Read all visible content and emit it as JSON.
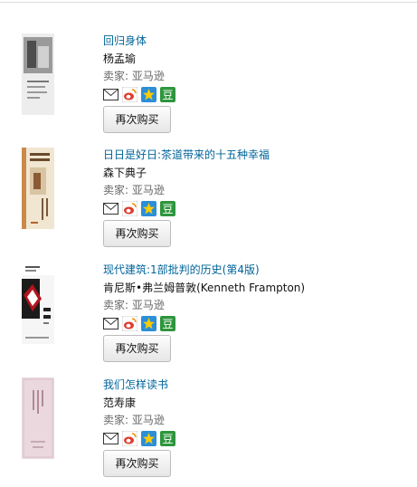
{
  "orders": [
    {
      "title": "回归身体",
      "author": "杨孟瑜",
      "seller": "卖家: 亚马逊",
      "rebuy_label": "再次购买",
      "cover": {
        "bg": "#e8e8e8",
        "accent": "#555555"
      }
    },
    {
      "title": "日日是好日:茶道带来的十五种幸福",
      "author": "森下典子",
      "seller": "卖家: 亚马逊",
      "rebuy_label": "再次购买",
      "cover": {
        "bg": "#efe3cc",
        "accent": "#b6642e"
      }
    },
    {
      "title": "现代建筑:1部批判的历史(第4版)",
      "author": "肯尼斯•弗兰姆普敦(Kenneth Frampton)",
      "seller": "卖家: 亚马逊",
      "rebuy_label": "再次购买",
      "cover": {
        "bg": "#f4f4f4",
        "accent": "#b3141c"
      }
    },
    {
      "title": "我们怎样读书",
      "author": "范寿康",
      "seller": "卖家: 亚马逊",
      "rebuy_label": "再次购买",
      "cover": {
        "bg": "#e9d7dd",
        "accent": "#c7a9b4"
      }
    }
  ],
  "share_icons": [
    "email-icon",
    "weibo-icon",
    "qzone-icon",
    "douban-icon"
  ],
  "share_glyphs": {
    "douban": "豆"
  },
  "colors": {
    "link": "#00649a",
    "seller": "#666666",
    "douban": "#2e963d",
    "qzone": "#2b8fd8",
    "weibo": "#e0392b"
  }
}
